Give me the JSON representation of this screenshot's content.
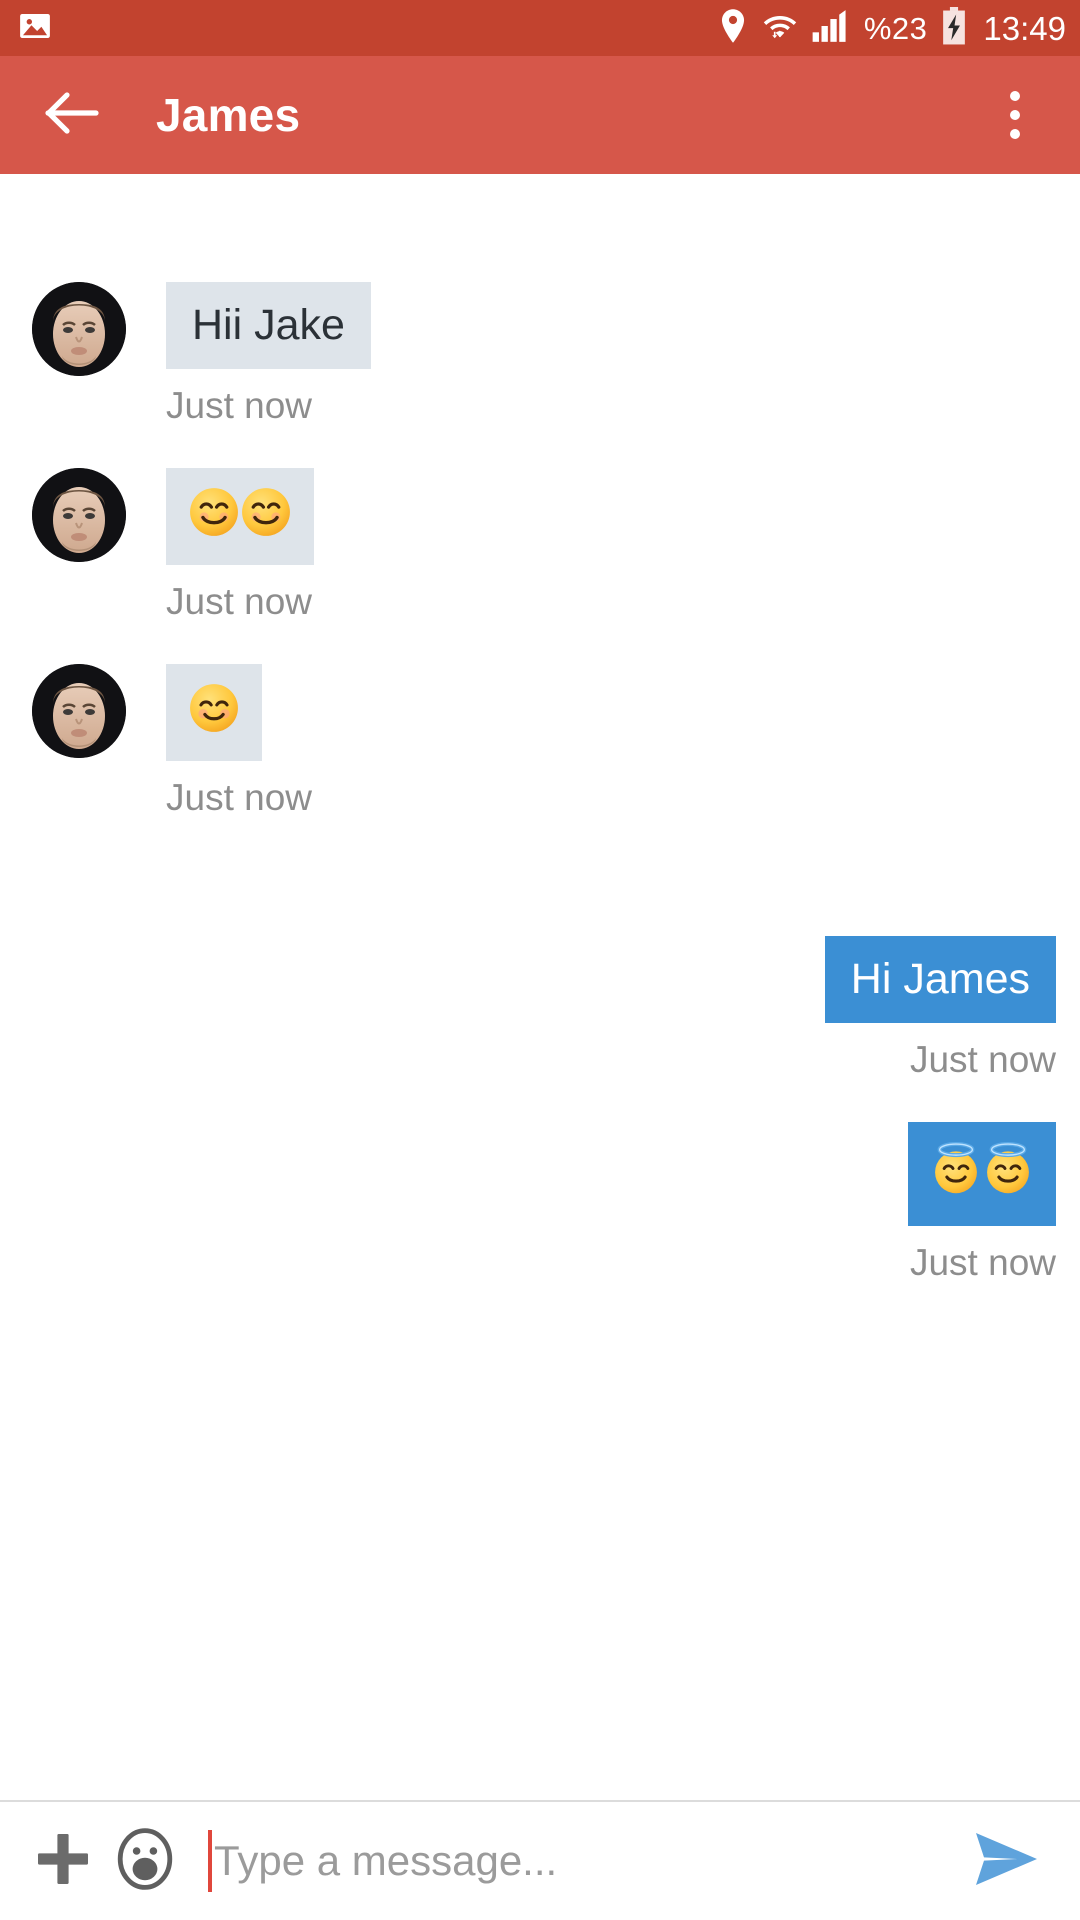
{
  "statusbar": {
    "left_icons": [
      {
        "name": "photo-icon",
        "glyph": "image"
      }
    ],
    "right_icons": [
      {
        "name": "location-pin-icon",
        "glyph": "pin"
      },
      {
        "name": "wifi-icon",
        "glyph": "wifi"
      },
      {
        "name": "cellular-signal-icon",
        "glyph": "signal"
      }
    ],
    "battery_percent": "%23",
    "battery_icon_name": "battery-charging-icon",
    "time": "13:49",
    "background_color": "#c2432f"
  },
  "appbar": {
    "back_icon_name": "back-arrow-icon",
    "title": "James",
    "overflow_icon_name": "overflow-menu-icon",
    "background_color": "#d6574a"
  },
  "conversation": {
    "incoming_bubble_color": "#dee4ea",
    "outgoing_bubble_color": "#3b8fd4",
    "timestamp_color": "#8d8d8d",
    "messages": [
      {
        "id": "m1",
        "direction": "incoming",
        "sender": "James",
        "type": "text",
        "text": "Hii Jake",
        "timestamp": "Just now",
        "avatar_name": "avatar-james"
      },
      {
        "id": "m2",
        "direction": "incoming",
        "sender": "James",
        "type": "emoji",
        "text": "😊😊",
        "emoji_name": "smiling-face-with-smiling-eyes",
        "emoji_count": 2,
        "timestamp": "Just now",
        "avatar_name": "avatar-james"
      },
      {
        "id": "m3",
        "direction": "incoming",
        "sender": "James",
        "type": "emoji",
        "text": "☺️",
        "emoji_name": "relaxed-smiling-face",
        "emoji_count": 1,
        "timestamp": "Just now",
        "avatar_name": "avatar-james"
      },
      {
        "id": "m4",
        "direction": "outgoing",
        "sender": "Jake",
        "type": "text",
        "text": "Hi James",
        "timestamp": "Just now"
      },
      {
        "id": "m5",
        "direction": "outgoing",
        "sender": "Jake",
        "type": "emoji",
        "text": "😇😇",
        "emoji_name": "smiling-face-with-halo",
        "emoji_count": 2,
        "timestamp": "Just now"
      }
    ]
  },
  "composer": {
    "attach_icon_name": "plus-icon",
    "emoji_icon_name": "emoji-face-icon",
    "placeholder": "Type a message...",
    "value": "",
    "send_icon_name": "send-icon",
    "send_icon_color": "#5fa3dc",
    "caret_color": "#e0473c"
  }
}
